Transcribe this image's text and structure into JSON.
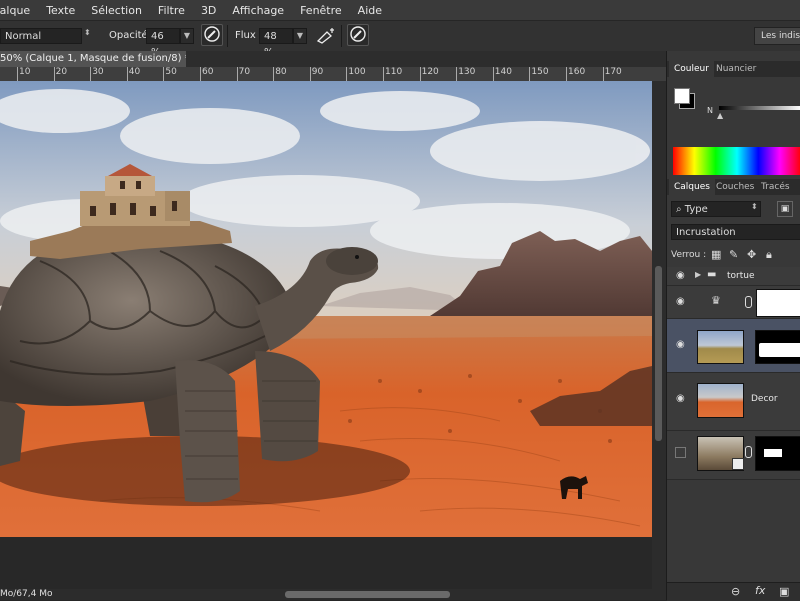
{
  "menu": {
    "items": [
      "Calque",
      "Texte",
      "Sélection",
      "Filtre",
      "3D",
      "Affichage",
      "Fenêtre",
      "Aide"
    ]
  },
  "options": {
    "mode_value": "Normal",
    "opacity_label": "Opacité :",
    "opacity_value": "46 %",
    "flux_label": "Flux :",
    "flux_value": "48 %",
    "workspace_button": "Les indisp"
  },
  "document": {
    "tab_title": "50% (Calque 1, Masque de fusion/8) *",
    "close_symbol": "×",
    "ruler_ticks": [
      "10",
      "20",
      "30",
      "40",
      "50",
      "60",
      "70",
      "80",
      "90",
      "100",
      "110",
      "120",
      "130",
      "140",
      "150",
      "160",
      "170"
    ],
    "status": "Mo/67,4 Mo"
  },
  "color_panel": {
    "tabs": [
      "Couleur",
      "Nuancier"
    ],
    "slider_label": "N"
  },
  "layers_panel": {
    "tabs": [
      "Calques",
      "Couches",
      "Tracés"
    ],
    "filter_value": "Type",
    "blend_value": "Incrustation",
    "lock_label": "Verrou :",
    "layers": [
      {
        "name": "tortue",
        "type": "group",
        "visible": true
      },
      {
        "name": "",
        "type": "adjustment",
        "visible": true
      },
      {
        "name": "",
        "type": "masked",
        "visible": true,
        "selected": true
      },
      {
        "name": "Decor",
        "type": "pixel",
        "visible": true
      },
      {
        "name": "",
        "type": "smart",
        "visible": false
      }
    ]
  },
  "icons": {
    "eye": "eye-icon",
    "folder": "folder-icon",
    "chain": "link-icon",
    "brush": "brush-icon",
    "airbrush": "airbrush-icon",
    "pressure": "pressure-icon",
    "lock": "lock-icon",
    "move": "move-icon",
    "fx": "fx-icon"
  },
  "colors": {
    "ui_dark": "#262626",
    "panel": "#383838",
    "selected_layer": "#4a5264"
  }
}
